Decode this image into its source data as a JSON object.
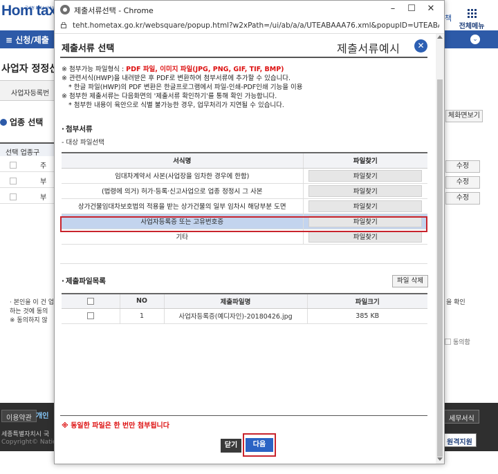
{
  "background": {
    "logo": "Hom tax",
    "logo_sub": "국세청 홈택스서비스",
    "top_right_partial": "책",
    "all_menu": "전체메뉴",
    "nav_label": "≡  신청/제출",
    "page_title": "사업자 정정신",
    "biz_label": "사업자등록번",
    "industry_title": "업종 선택",
    "view_button": "체화면보기",
    "table_header": "선택   업종구",
    "rows": [
      "주",
      "부",
      "부"
    ],
    "edit_label": "수정",
    "notice_line1": "· 본인을 이 건 업",
    "notice_line2": "하는 것에 동의",
    "notice_line3": "※ 동의하지 않",
    "notice_right": "을 확인",
    "agree_label": "동의함",
    "footer_terms": "이용약관",
    "footer_privacy": "개인",
    "footer_tax_form": "세무서식",
    "footer_addr": "세종특별자치시 국",
    "footer_copy": "Copyright© Natio",
    "footer_remote": "원격지원"
  },
  "window": {
    "title": "제출서류선택 - Chrome",
    "url": "teht.hometax.go.kr/websquare/popup.html?w2xPath=/ui/ab/a/a/UTEABAAA76.xml&popupID=UTEABAAA76&w2..."
  },
  "dialog": {
    "title": "제출서류 선택",
    "example_link": "제출서류예시",
    "guide": {
      "line1_prefix": "※ 첨부가능 파일형식 : ",
      "line1_formats": "PDF 파일, 이미지 파일(JPG, PNG, GIF, TIF, BMP)",
      "line2": "※ 관련서식(HWP)을 내려받은 후 PDF로 변환하여 첨부서류에 추가할 수 있습니다.",
      "line3": "* 한글 파일(HWP)의 PDF 변환은 한글프로그램에서 파일-인쇄-PDF인쇄 기능을 이용",
      "line4": "※ 첨부한 제출서류는 다음화면의 '제출서류 확인하기'를 통해 확인 가능합니다.",
      "line5": "* 첨부한 내용이 육안으로 식별 불가능한 경우, 업무처리가 지연될 수 있습니다."
    },
    "attach_section": "첨부서류",
    "target_files": "- 대상 파일선택",
    "docs_headers": {
      "form": "서식명",
      "find": "파일찾기"
    },
    "docs": [
      {
        "name": "임대차계약서 사본(사업장을 임차한 경우에 한함)",
        "button": "파일찾기"
      },
      {
        "name": "(법령에 의거) 허가·등록·신고사업으로 업종 정정시 그 사본",
        "button": "파일찾기"
      },
      {
        "name": "상가건물임대차보호법의 적용을 받는 상가건물의 일부 임차시 해당부분 도면",
        "button": "파일찾기"
      },
      {
        "name": "사업자등록증 또는 고유번호증",
        "button": "파일찾기",
        "selected": true
      },
      {
        "name": "기타",
        "button": "파일찾기"
      }
    ],
    "files_section": "제출파일목록",
    "delete_button": "파일 삭제",
    "files_headers": {
      "no": "NO",
      "name": "제출파일명",
      "size": "파일크기"
    },
    "files": [
      {
        "no": "1",
        "name": "사업자등록증(예디자인)-20180426.jpg",
        "size": "385 KB"
      }
    ],
    "warning": "※ 동일한 파일은 한 번만 첨부됩니다",
    "close_button": "닫기",
    "next_button": "다음"
  },
  "colors": {
    "accent_blue": "#2c5fb3",
    "highlight_row": "#c3d4ee",
    "warning_red": "#d11111",
    "annotation_red": "#c8232c"
  }
}
